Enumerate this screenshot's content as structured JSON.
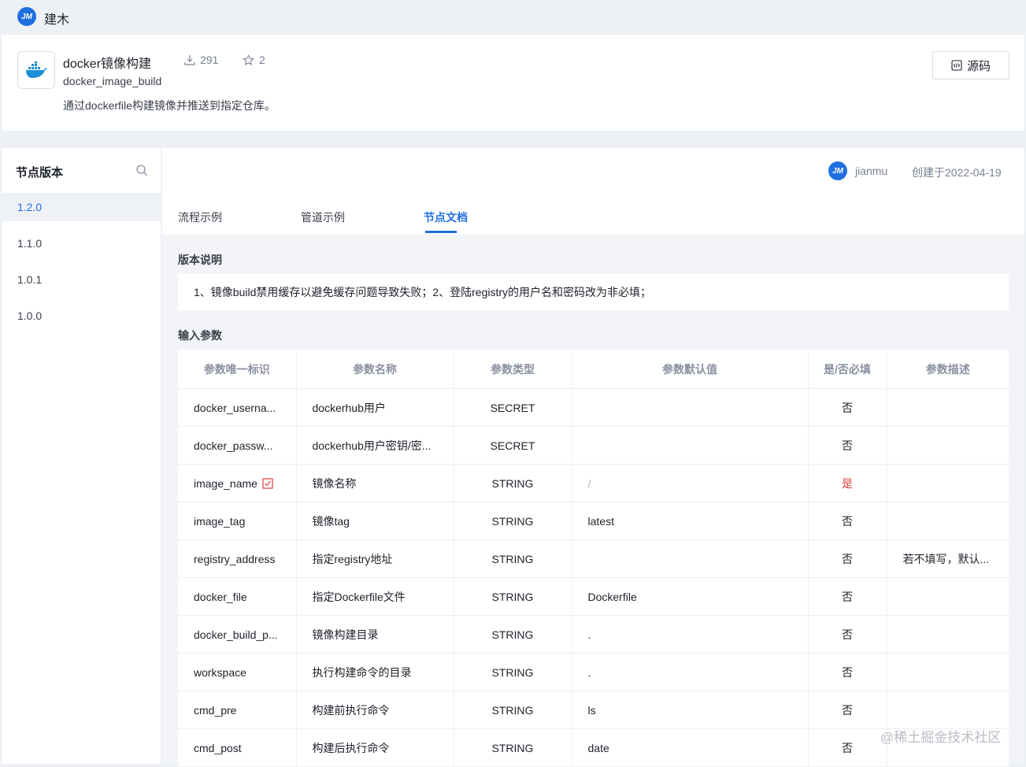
{
  "brand": {
    "logo_text": "JM",
    "name": "建木"
  },
  "node": {
    "title": "docker镜像构建",
    "ref": "docker_image_build",
    "description": "通过dockerfile构建镜像并推送到指定仓库。",
    "downloads": "291",
    "stars": "2",
    "source_button": "源码"
  },
  "sidebar": {
    "title": "节点版本",
    "versions": [
      "1.2.0",
      "1.1.0",
      "1.0.1",
      "1.0.0"
    ],
    "active_version": "1.2.0"
  },
  "meta": {
    "author_logo": "JM",
    "author": "jianmu",
    "created": "创建于2022-04-19"
  },
  "tabs": [
    {
      "label": "流程示例",
      "active": false
    },
    {
      "label": "管道示例",
      "active": false
    },
    {
      "label": "节点文档",
      "active": true
    }
  ],
  "release_notes": {
    "title": "版本说明",
    "text": "1、镜像build禁用缓存以避免缓存问题导致失败；2、登陆registry的用户名和密码改为非必填；"
  },
  "inputs": {
    "title": "输入参数",
    "columns": [
      "参数唯一标识",
      "参数名称",
      "参数类型",
      "参数默认值",
      "是/否必填",
      "参数描述"
    ],
    "rows": [
      {
        "id": "docker_userna...",
        "name": "dockerhub用户",
        "type": "SECRET",
        "default": "",
        "required": "否",
        "desc": ""
      },
      {
        "id": "docker_passw...",
        "name": "dockerhub用户密钥/密...",
        "type": "SECRET",
        "default": "",
        "required": "否",
        "desc": ""
      },
      {
        "id": "image_name",
        "name": "镜像名称",
        "type": "STRING",
        "default": "/",
        "required": "是",
        "desc": "",
        "flag": true
      },
      {
        "id": "image_tag",
        "name": "镜像tag",
        "type": "STRING",
        "default": "latest",
        "required": "否",
        "desc": ""
      },
      {
        "id": "registry_address",
        "name": "指定registry地址",
        "type": "STRING",
        "default": "",
        "required": "否",
        "desc": "若不填写，默认..."
      },
      {
        "id": "docker_file",
        "name": "指定Dockerfile文件",
        "type": "STRING",
        "default": "Dockerfile",
        "required": "否",
        "desc": ""
      },
      {
        "id": "docker_build_p...",
        "name": "镜像构建目录",
        "type": "STRING",
        "default": ".",
        "required": "否",
        "desc": ""
      },
      {
        "id": "workspace",
        "name": "执行构建命令的目录",
        "type": "STRING",
        "default": ".",
        "required": "否",
        "desc": ""
      },
      {
        "id": "cmd_pre",
        "name": "构建前执行命令",
        "type": "STRING",
        "default": "ls",
        "required": "否",
        "desc": ""
      },
      {
        "id": "cmd_post",
        "name": "构建后执行命令",
        "type": "STRING",
        "default": "date",
        "required": "否",
        "desc": ""
      }
    ]
  },
  "watermark": "@稀土掘金技术社区",
  "colors": {
    "accent": "#1f6fe0",
    "required": "#e23b3b"
  }
}
